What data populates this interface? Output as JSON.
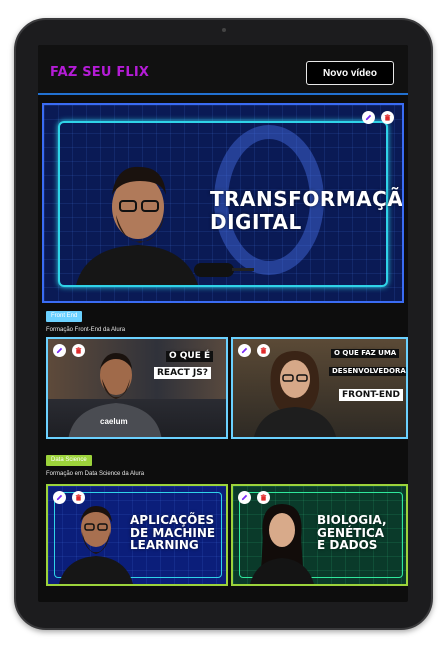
{
  "header": {
    "logo": "FAZ SEU FLIX",
    "new_video_label": "Novo vídeo"
  },
  "banner": {
    "title_line1": "TRANSFORMAÇÃO",
    "title_line2": "DIGITAL"
  },
  "categories": [
    {
      "name": "Front End",
      "subtitle": "Formação Front-End da Alura",
      "color": "#6bd1ff",
      "videos": [
        {
          "caption": [
            "O QUE É",
            "REACT JS?"
          ],
          "shirt_text": "caelum"
        },
        {
          "caption": [
            "O QUE FAZ UMA",
            "DESENVOLVEDORA",
            "FRONT-END"
          ]
        }
      ]
    },
    {
      "name": "Data Science",
      "subtitle": "Formação em Data Science da Alura",
      "color": "#9cd33b",
      "videos": [
        {
          "caption": [
            "APLICAÇÕES",
            "DE MACHINE",
            "LEARNING"
          ]
        },
        {
          "caption": [
            "BIOLOGIA,",
            "GENÉTICA",
            "E DADOS"
          ]
        }
      ]
    }
  ],
  "colors": {
    "accent_blue": "#2271d1",
    "logo_purple": "#b41cd6",
    "edit_icon": "#7b2cf5",
    "delete_icon": "#e02b2b"
  }
}
